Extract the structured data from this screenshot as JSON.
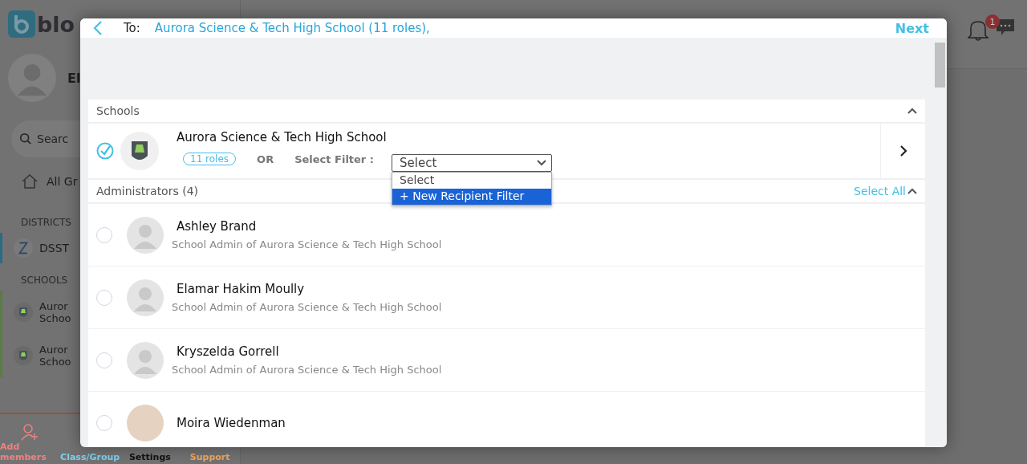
{
  "background": {
    "logo_text": "blo",
    "user_name": "El",
    "search_placeholder": "Searc",
    "all_groups": "All Gr",
    "districts_heading": "DISTRICTS",
    "districts": [
      {
        "name": "DSST"
      }
    ],
    "schools_heading": "SCHOOLS",
    "schools": [
      {
        "line1": "Auror",
        "line2": "Schoo"
      },
      {
        "line1": "Auror",
        "line2": "Schoo"
      }
    ],
    "notification_count": "1",
    "bottom_nav": [
      {
        "label": "Add members",
        "color": "#f08080"
      },
      {
        "label": "Class/Group",
        "color": "#7cd0f0"
      },
      {
        "label": "Settings",
        "color": "#111111"
      },
      {
        "label": "Support",
        "color": "#f0a860"
      }
    ]
  },
  "modal": {
    "to_label": "To:",
    "recipients": "Aurora Science & Tech High School (11 roles),",
    "next": "Next",
    "schools_section": {
      "title": "Schools",
      "expanded": true
    },
    "school": {
      "name": "Aurora Science & Tech High School",
      "checked": true,
      "roles": "11 roles",
      "or": "OR",
      "filter_label": "Select Filter :",
      "filter_value": "Select",
      "dropdown": {
        "open": true,
        "options": [
          {
            "label": "Select",
            "selected": false
          },
          {
            "label": "+ New Recipient Filter",
            "selected": true
          }
        ]
      }
    },
    "group": {
      "title": "Administrators (4)",
      "select_all": "Select All",
      "expanded": true
    },
    "members": [
      {
        "name": "Ashley Brand",
        "role": "School Admin of Aurora Science & Tech High School",
        "selected": false,
        "photo": false
      },
      {
        "name": "Elamar Hakim Moully",
        "role": "School Admin of Aurora Science & Tech High School",
        "selected": false,
        "photo": false
      },
      {
        "name": "Kryszelda Gorrell",
        "role": "School Admin of Aurora Science & Tech High School",
        "selected": false,
        "photo": false
      },
      {
        "name": "Moira Wiedenman",
        "selected": false,
        "photo": true
      }
    ]
  }
}
